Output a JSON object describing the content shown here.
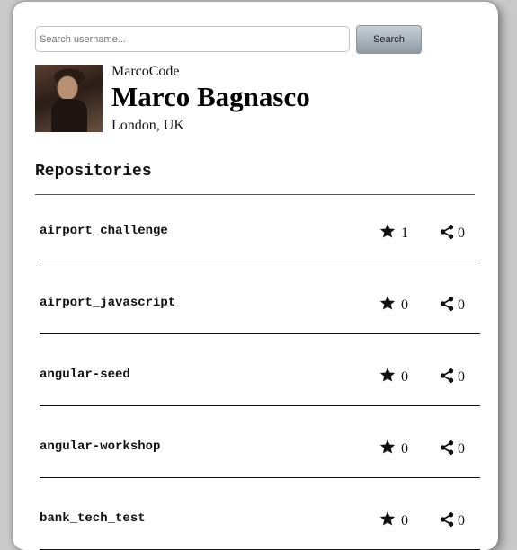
{
  "search": {
    "placeholder": "Search username...",
    "value": "",
    "button_label": "Search"
  },
  "profile": {
    "avatar_icon": "profile-photo",
    "username": "MarcoCode",
    "name": "Marco Bagnasco",
    "location": "London, UK"
  },
  "repositories": {
    "heading": "Repositories",
    "icons": {
      "stars": "star-icon",
      "forks": "share-icon"
    },
    "items": [
      {
        "name": "airport_challenge",
        "stars": "1",
        "forks": "0"
      },
      {
        "name": "airport_javascript",
        "stars": "0",
        "forks": "0"
      },
      {
        "name": "angular-seed",
        "stars": "0",
        "forks": "0"
      },
      {
        "name": "angular-workshop",
        "stars": "0",
        "forks": "0"
      },
      {
        "name": "bank_tech_test",
        "stars": "0",
        "forks": "0"
      }
    ]
  }
}
